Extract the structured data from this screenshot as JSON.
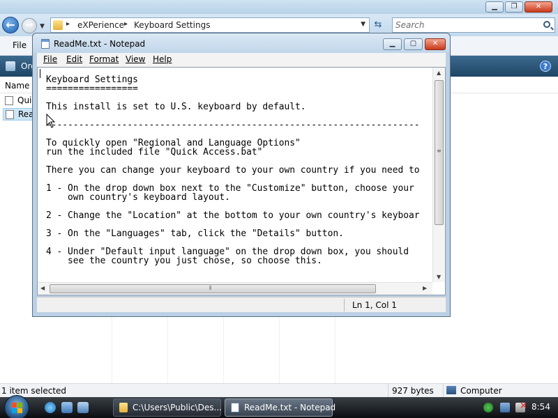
{
  "explorer": {
    "breadcrumb": [
      "eXPerience",
      "Keyboard Settings"
    ],
    "search_placeholder": "Search",
    "menu_file": "File",
    "toolbar_organize": "Org",
    "column_name": "Name",
    "files": [
      "Quick Access.bat",
      "ReadMe.txt"
    ],
    "file_labels_visible": [
      "Qui",
      "Rea"
    ],
    "status_selected": "1 item selected",
    "status_size": "927 bytes",
    "status_location": "Computer"
  },
  "notepad": {
    "title": "ReadMe.txt - Notepad",
    "menu": [
      {
        "label": "File"
      },
      {
        "label": "Edit"
      },
      {
        "label": "Format"
      },
      {
        "label": "View"
      },
      {
        "label": "Help"
      }
    ],
    "text": "Keyboard Settings\n=================\n\nThis install is set to U.S. keyboard by default.\n\n---------------------------------------------------------------------\n\nTo quickly open \"Regional and Language Options\"\nrun the included file \"Quick Access.bat\"\n\nThere you can change your keyboard to your own country if you need to\n\n1 - On the drop down box next to the \"Customize\" button, choose your\n    own country's keyboard layout.\n\n2 - Change the \"Location\" at the bottom to your own country's keyboar\n\n3 - On the \"Languages\" tab, click the \"Details\" button.\n\n4 - Under \"Default input language\" on the drop down box, you should\n    see the country you just chose, so choose this.",
    "status_position": "Ln 1, Col 1"
  },
  "taskbar": {
    "tasks": [
      {
        "label": "C:\\Users\\Public\\Des..."
      },
      {
        "label": "ReadMe.txt - Notepad"
      }
    ],
    "clock": "8:54"
  }
}
